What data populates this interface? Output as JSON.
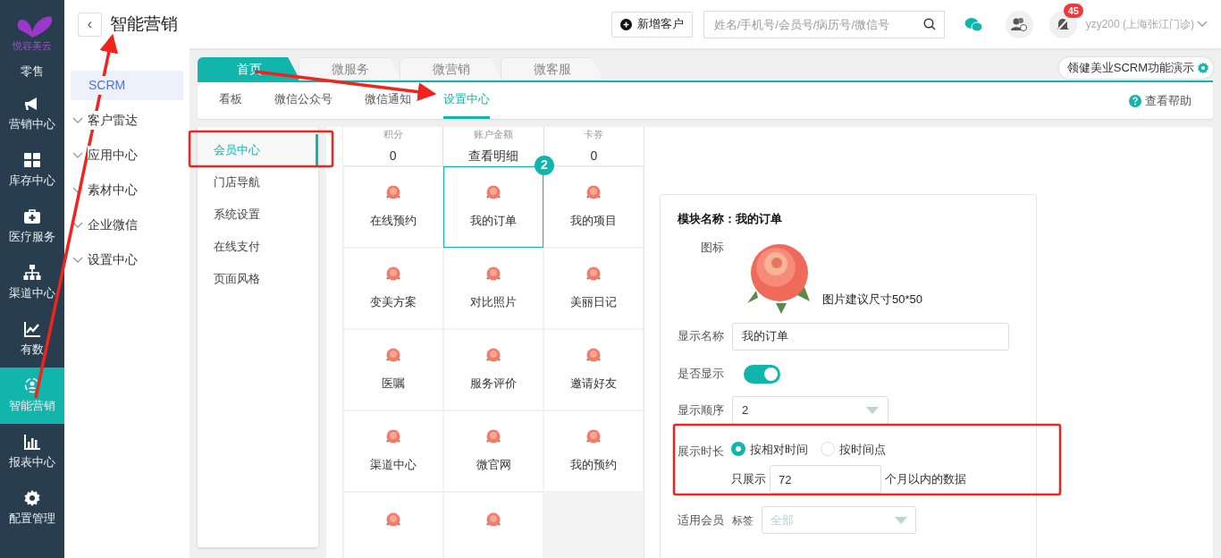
{
  "rail": {
    "logo_text": "悦容美云",
    "items": [
      {
        "label": "零售",
        "selected": false
      },
      {
        "label": "营销中心",
        "selected": false
      },
      {
        "label": "库存中心",
        "selected": false
      },
      {
        "label": "医疗服务",
        "selected": false
      },
      {
        "label": "渠道中心",
        "selected": false
      },
      {
        "label": "有数",
        "selected": false
      },
      {
        "label": "智能营销",
        "selected": true
      },
      {
        "label": "报表中心",
        "selected": false
      },
      {
        "label": "配置管理",
        "selected": false
      }
    ]
  },
  "header": {
    "back": "‹",
    "title": "智能营销",
    "add_button": "新增客户",
    "search": {
      "placeholder": "姓名/手机号/会员号/病历号/微信号"
    },
    "notification_count": "45",
    "user": "yzy200 (上海张江门诊)"
  },
  "menu": {
    "items": [
      {
        "label": "SCRM",
        "selected": true,
        "expandable": false
      },
      {
        "label": "客户雷达",
        "selected": false,
        "expandable": true
      },
      {
        "label": "应用中心",
        "selected": false,
        "expandable": true
      },
      {
        "label": "素材中心",
        "selected": false,
        "expandable": true
      },
      {
        "label": "企业微信",
        "selected": false,
        "expandable": true
      },
      {
        "label": "设置中心",
        "selected": false,
        "expandable": true
      }
    ]
  },
  "tabs": [
    {
      "label": "首页",
      "selected": true
    },
    {
      "label": "微服务",
      "selected": false
    },
    {
      "label": "微营销",
      "selected": false
    },
    {
      "label": "微客服",
      "selected": false
    }
  ],
  "account_chip": "领健美业SCRM功能演示",
  "subtabs": [
    {
      "label": "看板",
      "selected": false
    },
    {
      "label": "微信公众号",
      "selected": false
    },
    {
      "label": "微信通知",
      "selected": false
    },
    {
      "label": "设置中心",
      "selected": true
    }
  ],
  "help": "查看帮助",
  "settings_menu": [
    {
      "label": "会员中心",
      "selected": true
    },
    {
      "label": "门店导航",
      "selected": false
    },
    {
      "label": "系统设置",
      "selected": false
    },
    {
      "label": "在线支付",
      "selected": false
    },
    {
      "label": "页面风格",
      "selected": false
    }
  ],
  "preview": {
    "stats": [
      {
        "label": "积分",
        "value": "0"
      },
      {
        "label": "账户金额",
        "value": "查看明细"
      },
      {
        "label": "卡券",
        "value": "0"
      }
    ],
    "modules": [
      {
        "kind": "module",
        "label": "在线预约",
        "selected": false
      },
      {
        "kind": "module",
        "label": "我的订单",
        "selected": true,
        "badge": "2"
      },
      {
        "kind": "module",
        "label": "我的项目",
        "selected": false
      },
      {
        "kind": "module",
        "label": "变美方案",
        "selected": false
      },
      {
        "kind": "module",
        "label": "对比照片",
        "selected": false
      },
      {
        "kind": "module",
        "label": "美丽日记",
        "selected": false
      },
      {
        "kind": "module",
        "label": "医嘱",
        "selected": false
      },
      {
        "kind": "module",
        "label": "服务评价",
        "selected": false
      },
      {
        "kind": "module",
        "label": "邀请好友",
        "selected": false
      },
      {
        "kind": "module",
        "label": "渠道中心",
        "selected": false
      },
      {
        "kind": "module",
        "label": "微官网",
        "selected": false
      },
      {
        "kind": "module",
        "label": "我的预约",
        "selected": false
      },
      {
        "kind": "icon_only",
        "selected": false
      },
      {
        "kind": "icon_only",
        "selected": false
      },
      {
        "kind": "empty"
      }
    ]
  },
  "editor": {
    "title": "模块名称：我的订单",
    "icon_label": "图标",
    "icon_hint": "图片建议尺寸50*50",
    "name_label": "显示名称",
    "name_value": "我的订单",
    "show_label": "是否显示",
    "show_on": true,
    "order_label": "显示顺序",
    "order_value": "2",
    "duration_label": "展示时长",
    "duration_options": [
      {
        "label": "按相对时间",
        "selected": true
      },
      {
        "label": "按时间点",
        "selected": false
      }
    ],
    "duration_prefix": "只展示",
    "duration_value": "72",
    "duration_suffix": "个月以内的数据",
    "members_label": "适用会员",
    "tag_label": "标签",
    "tag_placeholder": "全部"
  }
}
